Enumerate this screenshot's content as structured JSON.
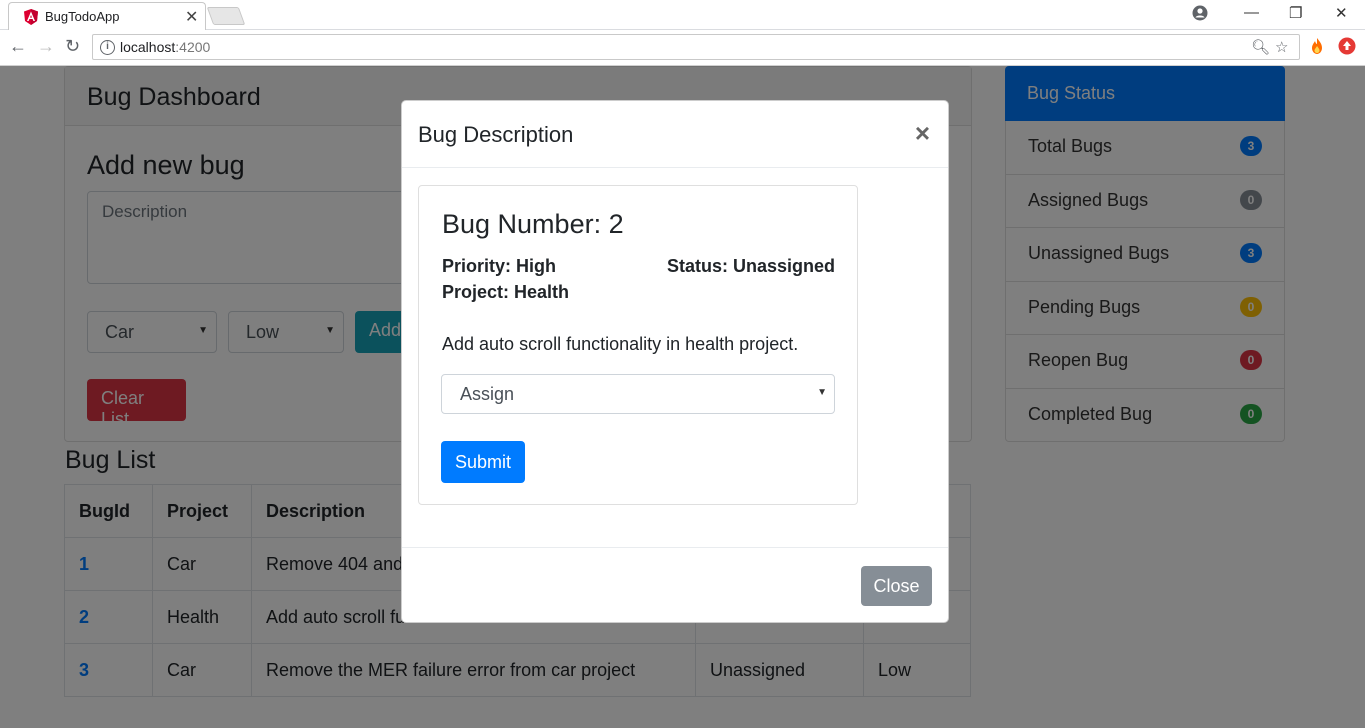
{
  "browser": {
    "tab_title": "BugTodoApp",
    "tab_close": "✕",
    "url_host": "localhost",
    "url_port": ":4200",
    "minimize": "—",
    "restore": "❐",
    "close": "✕"
  },
  "dashboard": {
    "title": "Bug Dashboard",
    "add_heading": "Add new bug",
    "description_placeholder": "Description",
    "project_select": "Car",
    "priority_select": "Low",
    "add_button": "Add",
    "clear_button": "Clear List"
  },
  "bug_list": {
    "heading": "Bug List",
    "columns": [
      "BugId",
      "Project",
      "Description",
      "",
      ""
    ],
    "rows": [
      {
        "id": "1",
        "project": "Car",
        "description": "Remove 404 and",
        "status": "",
        "priority": ""
      },
      {
        "id": "2",
        "project": "Health",
        "description": "Add auto scroll fu",
        "status": "",
        "priority": ""
      },
      {
        "id": "3",
        "project": "Car",
        "description": "Remove the MER failure error from car project",
        "status": "Unassigned",
        "priority": "Low"
      }
    ]
  },
  "bug_status": {
    "title": "Bug Status",
    "items": [
      {
        "label": "Total Bugs",
        "count": "3",
        "color": "#007bff"
      },
      {
        "label": "Assigned Bugs",
        "count": "0",
        "color": "#868e96"
      },
      {
        "label": "Unassigned Bugs",
        "count": "3",
        "color": "#007bff"
      },
      {
        "label": "Pending Bugs",
        "count": "0",
        "color": "#ffc107"
      },
      {
        "label": "Reopen Bug",
        "count": "0",
        "color": "#dc3545"
      },
      {
        "label": "Completed Bug",
        "count": "0",
        "color": "#28a745"
      }
    ]
  },
  "modal": {
    "title": "Bug Description",
    "close_x": "×",
    "bug_number": "Bug Number: 2",
    "priority": "Priority: High",
    "status": "Status: Unassigned",
    "project": "Project: Health",
    "description": "Add auto scroll functionality in health project.",
    "assign_select": "Assign",
    "submit_button": "Submit",
    "close_button": "Close"
  },
  "colors": {
    "primary": "#007bff",
    "danger": "#dc3545",
    "info": "#17a2b8",
    "secondary": "#868e96"
  }
}
